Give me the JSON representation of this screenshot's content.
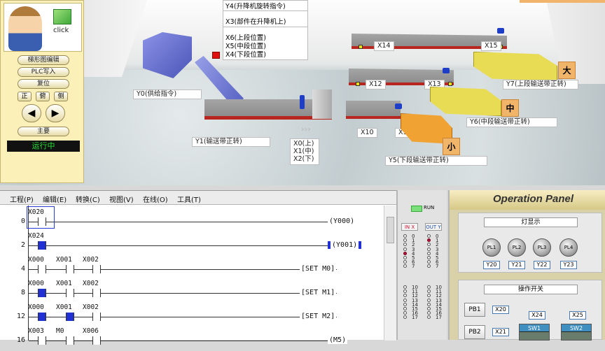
{
  "scene": {
    "top_labels": [
      "Y4(升降机旋转指令)",
      "X3(部件在升降机上)",
      "X6(上段位置)",
      "X5(中段位置)",
      "X4(下段位置)"
    ],
    "y0_label": "Y0(供给指令)",
    "y1_label": "Y1(输送带正转)",
    "x_lift_labels": [
      "X0(上)",
      "X1(中)",
      "X2(下)"
    ],
    "x14": "X14",
    "x15": "X15",
    "x12": "X12",
    "x13": "X13",
    "x10": "X10",
    "x11": "X11",
    "y7_label": "Y7(上段输送带正转)",
    "y6_label": "Y6(中段输送带正转)",
    "y5_label": "Y5(下段输送带正转)",
    "size_big": "大",
    "size_mid": "中",
    "size_small": "小"
  },
  "control": {
    "click_label": "click",
    "btn_ladder": "梯形图编辑",
    "btn_plc_write": "PLC写入",
    "btn_reset": "复位",
    "view_front": "正",
    "view_top": "俯",
    "view_side": "侧",
    "arrow_left": "◀",
    "arrow_right": "▶",
    "btn_main": "主要",
    "status": "运行中"
  },
  "menu": [
    "工程(P)",
    "编辑(E)",
    "转换(C)",
    "视图(V)",
    "在线(O)",
    "工具(T)"
  ],
  "ladder": {
    "rungs": [
      {
        "num": "0",
        "contacts": [
          "X020"
        ],
        "out": "Y000"
      },
      {
        "num": "2",
        "contacts": [
          "X024"
        ],
        "out": "Y001"
      },
      {
        "num": "4",
        "contacts": [
          "X000",
          "X001",
          "X002"
        ],
        "out": "SET    M0"
      },
      {
        "num": "8",
        "contacts": [
          "X000",
          "X001",
          "X002"
        ],
        "out": "SET    M1"
      },
      {
        "num": "12",
        "contacts": [
          "X000",
          "X001",
          "X002"
        ],
        "out": "SET    M2"
      },
      {
        "num": "16",
        "contacts": [
          "X003",
          "M0",
          "X006"
        ],
        "out": "M5"
      }
    ]
  },
  "io": {
    "run_label": "RUN",
    "in_label": "IN X",
    "out_label": "OUT Y",
    "nums_a": [
      "0",
      "1",
      "2",
      "3",
      "4",
      "5",
      "6",
      "7"
    ],
    "nums_b": [
      "10",
      "11",
      "12",
      "13",
      "14",
      "15",
      "16",
      "17"
    ]
  },
  "panel": {
    "title": "Operation Panel",
    "lamp_section": "灯显示",
    "lamps": [
      "PL1",
      "PL2",
      "PL3",
      "PL4"
    ],
    "lamp_addrs": [
      "Y20",
      "Y21",
      "Y22",
      "Y23"
    ],
    "switch_section": "操作开关",
    "pb1": "PB1",
    "pb1_addr": "X20",
    "pb2": "PB2",
    "pb2_addr": "X21",
    "sw1_addr": "X24",
    "sw2_addr": "X25",
    "sw1": "SW1",
    "sw2": "SW2"
  }
}
